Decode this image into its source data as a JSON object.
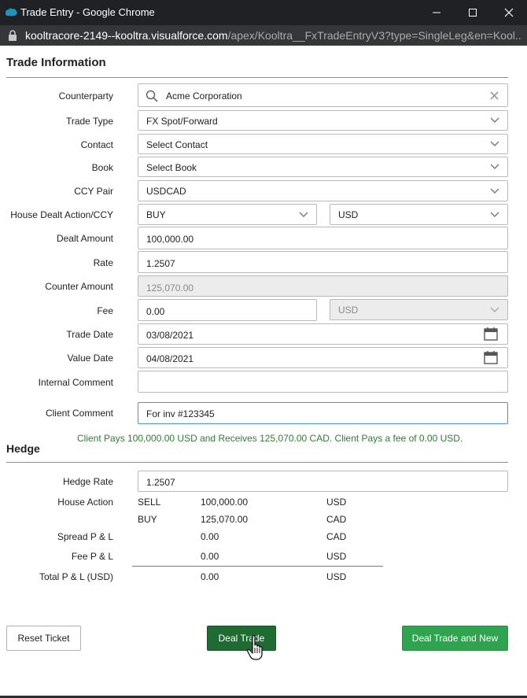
{
  "window": {
    "title": "Trade Entry - Google Chrome",
    "brand_color": "#1798c1",
    "icons": {
      "logo": "salesforce-cloud-icon",
      "minimize": "minimize-icon",
      "maximize": "maximize-icon",
      "close": "close-icon"
    }
  },
  "urlbar": {
    "host": "kooltracore-2149--kooltra.visualforce.com",
    "path": "/apex/Kooltra__FxTradeEntryV3?type=SingleLeg&en=Kool..."
  },
  "trade_info": {
    "title": "Trade Information",
    "counterparty": {
      "label": "Counterparty",
      "value": "Acme Corporation"
    },
    "trade_type": {
      "label": "Trade Type",
      "value": "FX Spot/Forward"
    },
    "contact": {
      "label": "Contact",
      "value": "Select Contact"
    },
    "book": {
      "label": "Book",
      "value": "Select Book"
    },
    "ccy_pair": {
      "label": "CCY Pair",
      "value": "USDCAD"
    },
    "house_dealt": {
      "label": "House Dealt Action/CCY",
      "action": "BUY",
      "ccy": "USD"
    },
    "dealt_amount": {
      "label": "Dealt Amount",
      "value": "100,000.00"
    },
    "rate": {
      "label": "Rate",
      "value": "1.2507"
    },
    "counter_amount": {
      "label": "Counter Amount",
      "value": "125,070.00"
    },
    "fee": {
      "label": "Fee",
      "value": "0.00",
      "ccy": "USD"
    },
    "trade_date": {
      "label": "Trade Date",
      "value": "03/08/2021"
    },
    "value_date": {
      "label": "Value Date",
      "value": "04/08/2021"
    },
    "internal_comment": {
      "label": "Internal Comment",
      "value": ""
    },
    "client_comment": {
      "label": "Client Comment",
      "value": "For inv #123345"
    },
    "summary": "Client Pays 100,000.00 USD and Receives 125,070.00 CAD. Client Pays a fee of 0.00 USD.",
    "summary_color": "#2e7d32"
  },
  "hedge": {
    "title": "Hedge",
    "hedge_rate": {
      "label": "Hedge Rate",
      "value": "1.2507"
    },
    "house_action": {
      "label": "House Action",
      "rows": [
        {
          "action": "SELL",
          "amount": "100,000.00",
          "ccy": "USD"
        },
        {
          "action": "BUY",
          "amount": "125,070.00",
          "ccy": "CAD"
        }
      ]
    },
    "spread_pl": {
      "label": "Spread P & L",
      "amount": "0.00",
      "ccy": "CAD"
    },
    "fee_pl": {
      "label": "Fee P & L",
      "amount": "0.00",
      "ccy": "USD"
    },
    "total_pl": {
      "label": "Total P & L (USD)",
      "amount": "0.00",
      "ccy": "USD"
    }
  },
  "buttons": {
    "reset": "Reset Ticket",
    "deal": "Deal Trade",
    "deal_new": "Deal Trade and New",
    "deal_color": "#1e6b33",
    "deal_new_color": "#2ea44f"
  }
}
